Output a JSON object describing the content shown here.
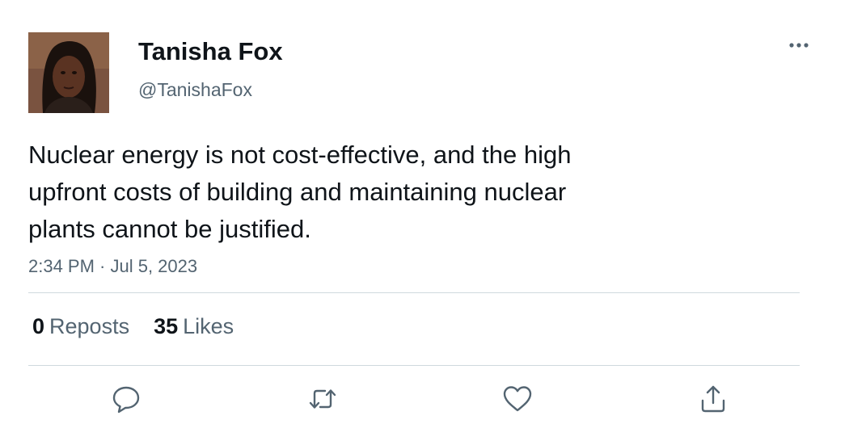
{
  "tweet": {
    "author": {
      "display_name": "Tanisha Fox",
      "handle": "@TanishaFox"
    },
    "text": "Nuclear energy is not cost-effective, and the high\nupfront costs of building and maintaining nuclear\nplants cannot be justified.",
    "timestamp": "2:34 PM · Jul 5, 2023",
    "stats": {
      "reposts_count": "0",
      "reposts_label": "Reposts",
      "likes_count": "35",
      "likes_label": "Likes"
    },
    "actions": [
      "reply-icon",
      "repost-icon",
      "like-icon",
      "share-icon"
    ]
  },
  "colors": {
    "text_primary": "#0f1419",
    "text_secondary": "#536471",
    "divider": "#cfd9de"
  }
}
